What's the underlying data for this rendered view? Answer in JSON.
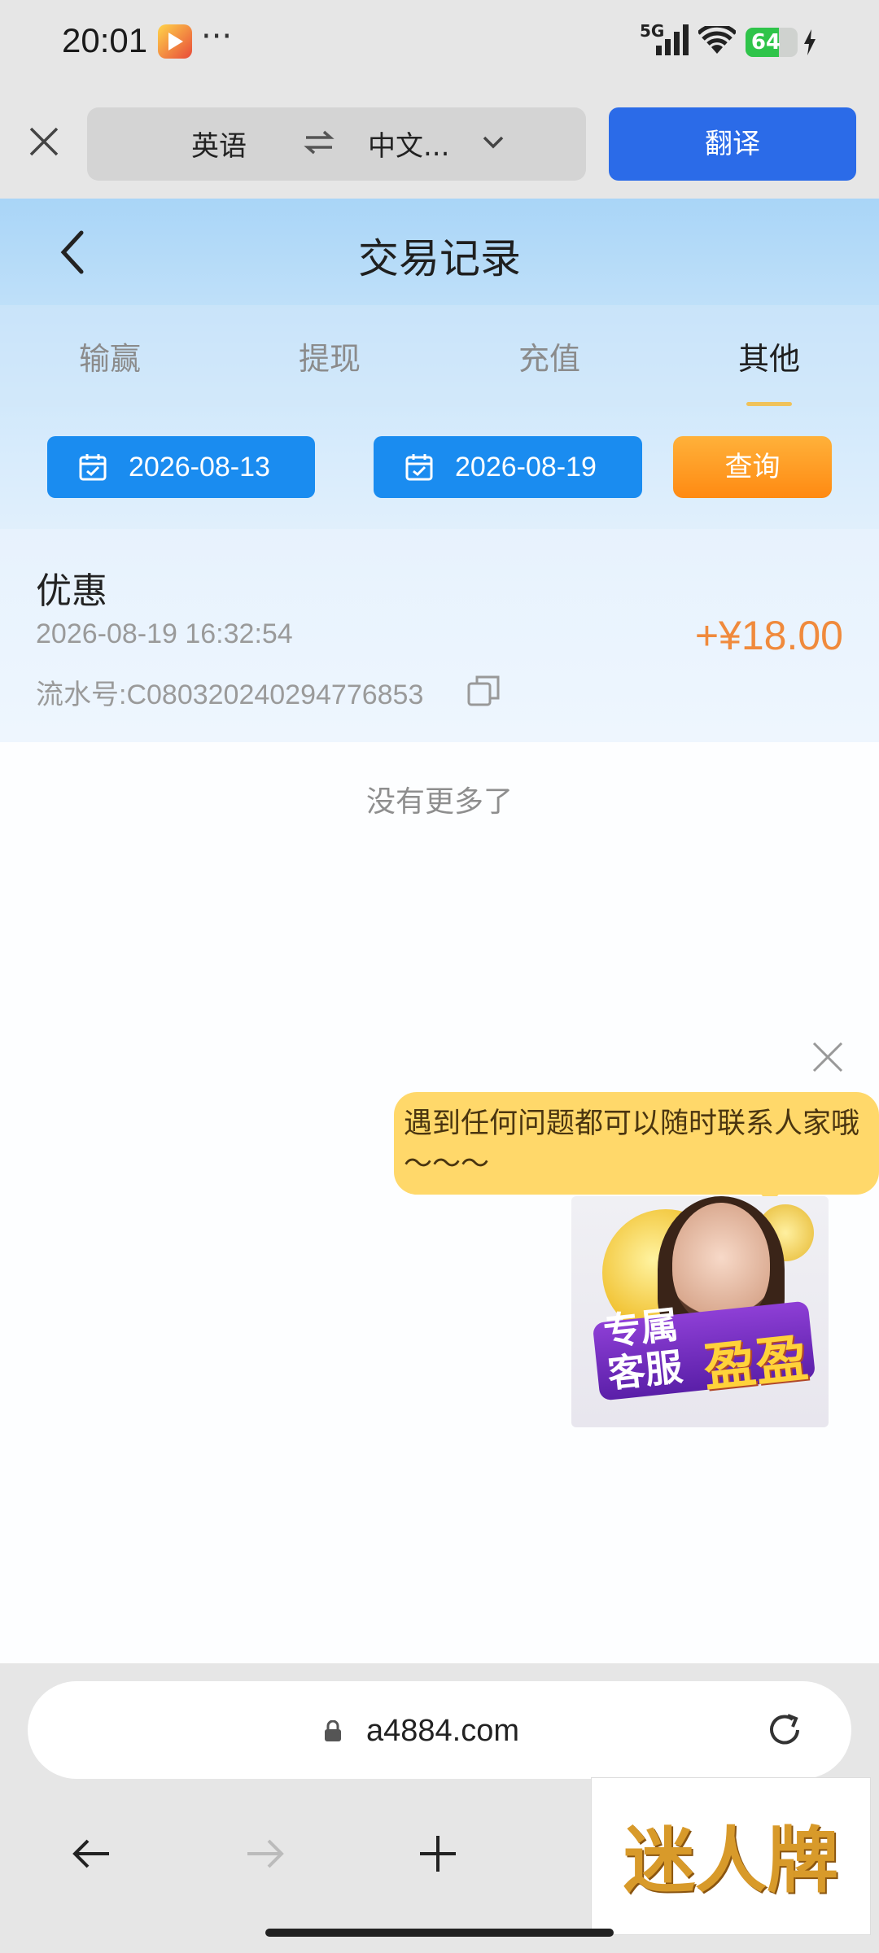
{
  "status_bar": {
    "time": "20:01",
    "more": "···",
    "network": "5G",
    "battery": "64",
    "battery_level": 0.64
  },
  "translate_bar": {
    "source_lang": "英语",
    "target_lang": "中文...",
    "translate_button": "翻译"
  },
  "header": {
    "title": "交易记录"
  },
  "tabs": [
    {
      "label": "输赢",
      "active": false
    },
    {
      "label": "提现",
      "active": false
    },
    {
      "label": "充值",
      "active": false
    },
    {
      "label": "其他",
      "active": true
    }
  ],
  "filters": {
    "start_date": "2026-08-13",
    "end_date": "2026-08-19",
    "query_button": "查询"
  },
  "records": [
    {
      "type": "优惠",
      "time": "2026-08-19 16:32:54",
      "serial": "流水号:C080320240294776853",
      "amount": "+¥18.00"
    }
  ],
  "no_more": "没有更多了",
  "support": {
    "bubble_text": "遇到任何问题都可以随时联系人家哦～～～",
    "banner_line1": "专属",
    "banner_line2": "客服",
    "banner_name": "盈盈"
  },
  "browser": {
    "url": "a4884.com"
  },
  "logo": {
    "text": "迷人牌"
  },
  "colors": {
    "accent_blue": "#1a8cf0",
    "translate_blue": "#2b6be8",
    "query_orange": "#ff8a12",
    "amount_orange": "#f08a3c"
  }
}
